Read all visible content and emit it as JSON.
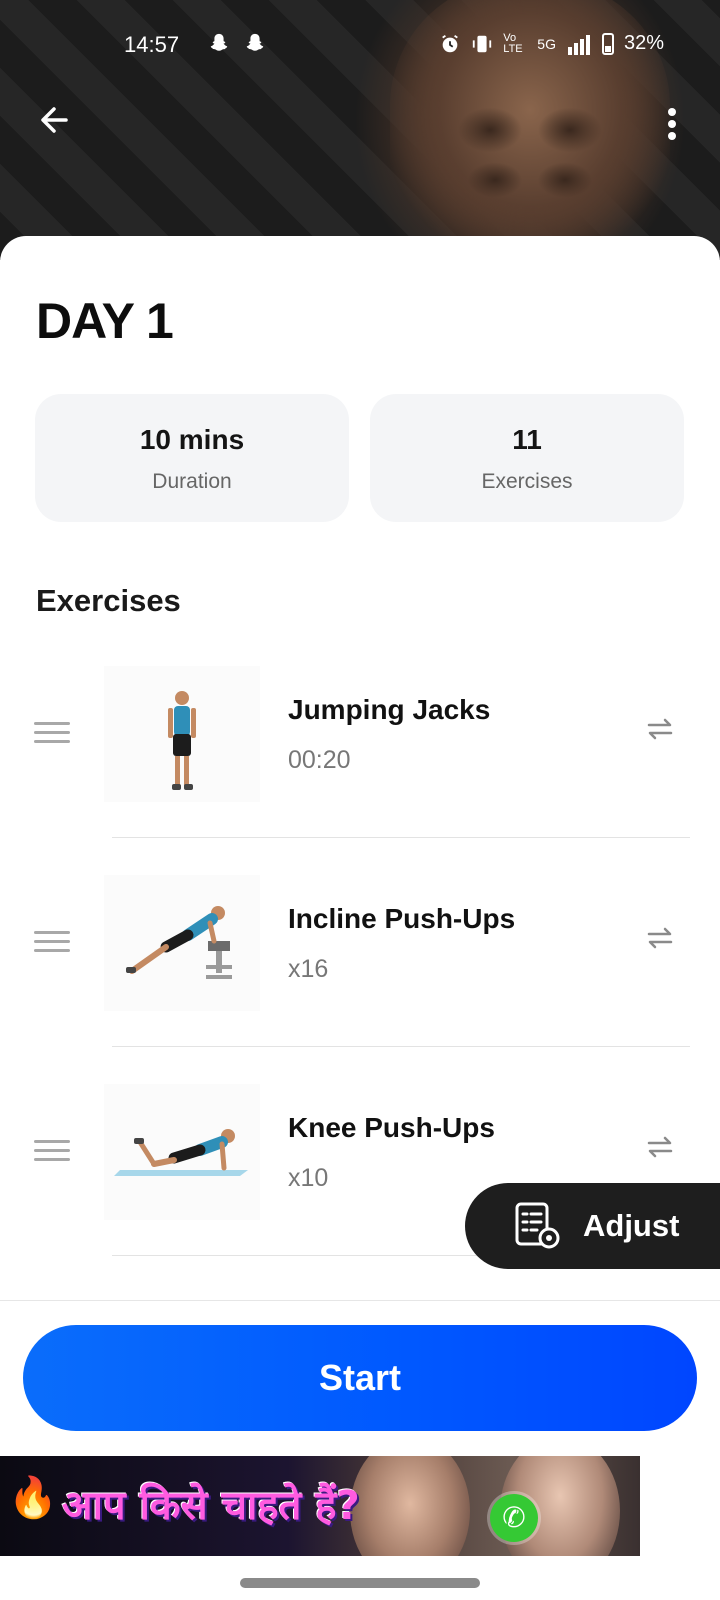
{
  "status_bar": {
    "time": "14:57",
    "left_icons": [
      "snapchat-icon",
      "snapchat-icon"
    ],
    "right_icons": [
      "alarm-icon",
      "vibrate-icon",
      "volte-icon",
      "5g-signal-icon",
      "battery-icon"
    ],
    "vo_lte": "Vo LTE",
    "network": "5G",
    "battery": "32%"
  },
  "header": {
    "back_icon": "arrow-left-icon",
    "more_icon": "more-vertical-icon"
  },
  "workout": {
    "title": "DAY 1",
    "stats": [
      {
        "value": "10 mins",
        "label": "Duration"
      },
      {
        "value": "11",
        "label": "Exercises"
      }
    ]
  },
  "exercises": {
    "section_title": "Exercises",
    "items": [
      {
        "name": "Jumping Jacks",
        "amount": "00:20"
      },
      {
        "name": "Incline Push-Ups",
        "amount": "x16"
      },
      {
        "name": "Knee Push-Ups",
        "amount": "x10"
      }
    ]
  },
  "adjust": {
    "label": "Adjust",
    "icon": "checklist-icon"
  },
  "start": {
    "label": "Start",
    "color": "#0062ff"
  },
  "ad": {
    "text": "आप किसे चाहते हैं?",
    "call_icon": "phone-icon"
  },
  "colors": {
    "accent": "#0062ff",
    "card_bg": "#f4f5f7",
    "adjust_bg": "#1e1e1e"
  }
}
